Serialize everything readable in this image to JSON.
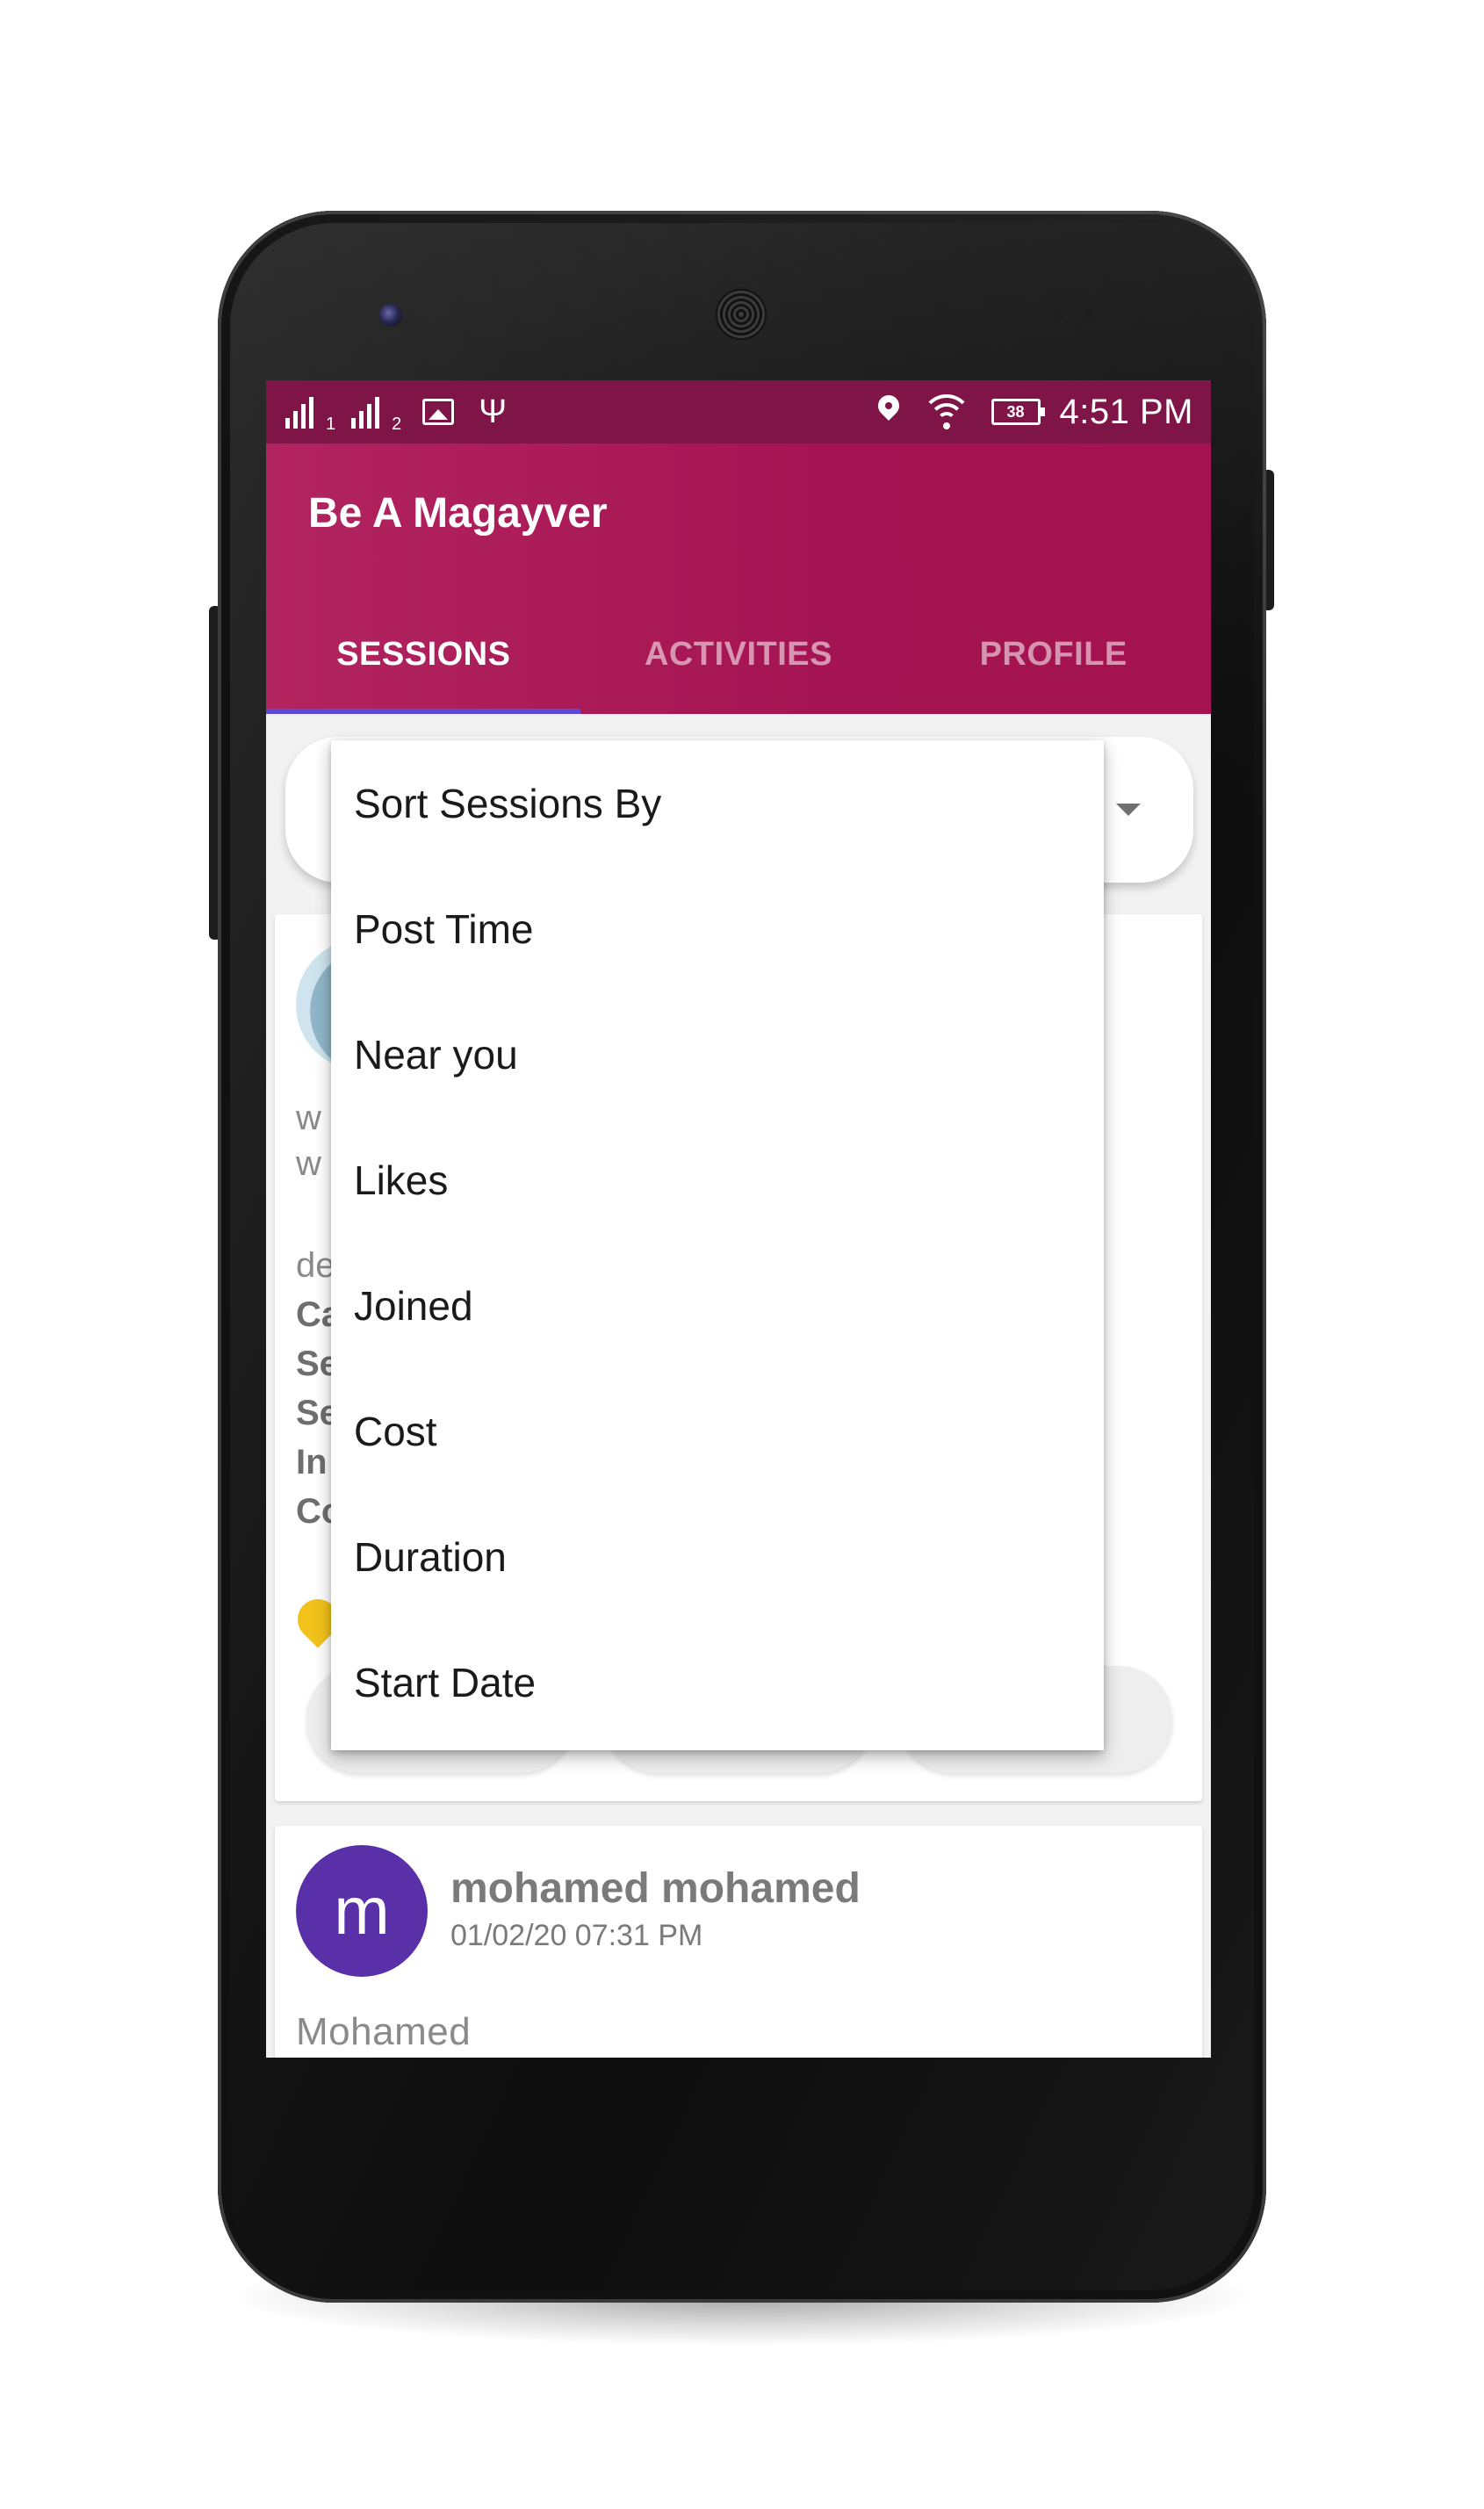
{
  "status_bar": {
    "sim1_label": "1",
    "sim2_label": "2",
    "battery_level": "38",
    "time": "4:51 PM",
    "icons": [
      "signal-icon",
      "signal-icon",
      "gallery-icon",
      "usb-icon",
      "location-icon",
      "wifi-icon",
      "battery-icon"
    ]
  },
  "app_bar": {
    "title": "Be A Magayver"
  },
  "tabs": [
    {
      "label": "SESSIONS",
      "active": true
    },
    {
      "label": "ACTIVITIES",
      "active": false
    },
    {
      "label": "PROFILE",
      "active": false
    }
  ],
  "sort_menu": {
    "items": [
      "Sort Sessions By",
      "Post Time",
      "Near you",
      "Likes",
      "Joined",
      "Cost",
      "Duration",
      "Start Date"
    ]
  },
  "session_card_1": {
    "visible_fragments": [
      "w",
      "w",
      "de",
      "Ca",
      "Se",
      "Se",
      "In",
      "Co"
    ]
  },
  "session_card_2": {
    "avatar_letter": "m",
    "author_name": "mohamed mohamed",
    "post_time": "01/02/20 07:31 PM",
    "body": "Mohamed"
  },
  "colors": {
    "status_bar": "#7f1547",
    "app_bar": "#a41452",
    "tab_indicator": "#5d4bd8",
    "avatar": "#5a30a8",
    "pin": "#f2c21b"
  }
}
